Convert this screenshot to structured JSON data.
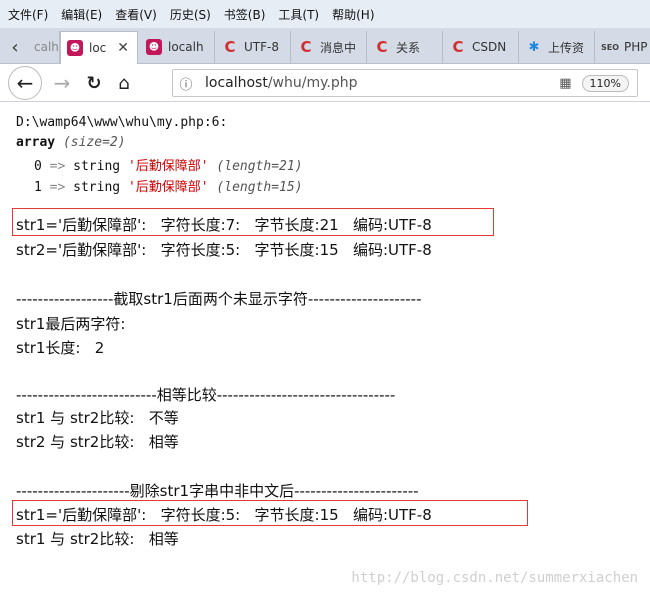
{
  "menu": {
    "items": [
      "文件(F)",
      "编辑(E)",
      "查看(V)",
      "历史(S)",
      "书签(B)",
      "工具(T)",
      "帮助(H)"
    ]
  },
  "tabs": [
    {
      "label": "calh",
      "icon": "cat-icon"
    },
    {
      "label": "loc",
      "icon": "cat-icon"
    },
    {
      "label": "localh",
      "icon": "cat-icon"
    },
    {
      "label": "UTF-8",
      "icon": "csdn-c-icon"
    },
    {
      "label": "消息中",
      "icon": "csdn-c-icon"
    },
    {
      "label": "关系",
      "icon": "csdn-c-icon"
    },
    {
      "label": "CSDN",
      "icon": "csdn-c-icon"
    },
    {
      "label": "上传资",
      "icon": "message-icon"
    },
    {
      "label": "PHP",
      "icon": "seo-icon"
    }
  ],
  "nav": {
    "url_host": "localhost",
    "url_path": "/whu/my.php",
    "zoom": "110%"
  },
  "dump": {
    "file_line": "D:\\wamp64\\www\\whu\\my.php:6:",
    "array_kw": "array",
    "size": "(size=2)",
    "items": [
      {
        "index": "0",
        "arrow": "=>",
        "type": "string",
        "value": "'后勤保障部'",
        "length": "(length=21)"
      },
      {
        "index": "1",
        "arrow": "=>",
        "type": "string",
        "value": "'后勤保障部'",
        "length": "(length=15)"
      }
    ]
  },
  "output": {
    "line1": "str1='后勤保障部':   字符长度:7:   字节长度:21   编码:UTF-8",
    "line2": "str2='后勤保障部':   字符长度:5:   字节长度:15   编码:UTF-8",
    "sep1": "------------------截取str1后面两个未显示字符---------------------",
    "line3": "str1最后两字符:",
    "line4": "str1长度:   2",
    "sep2": "--------------------------相等比较---------------------------------",
    "line5": "str1 与 str2比较:   不等",
    "line6": "str2 与 str2比较:   相等",
    "sep3": "---------------------剔除str1字串中非中文后-----------------------",
    "line7": "str1='后勤保障部':   字符长度:5:   字节长度:15   编码:UTF-8",
    "line8": "str1 与 str2比较:   相等"
  },
  "watermark": "http://blog.csdn.net/summerxiachen",
  "colors": {
    "highlight_box": "#e53935",
    "string_value": "#cc0000"
  }
}
